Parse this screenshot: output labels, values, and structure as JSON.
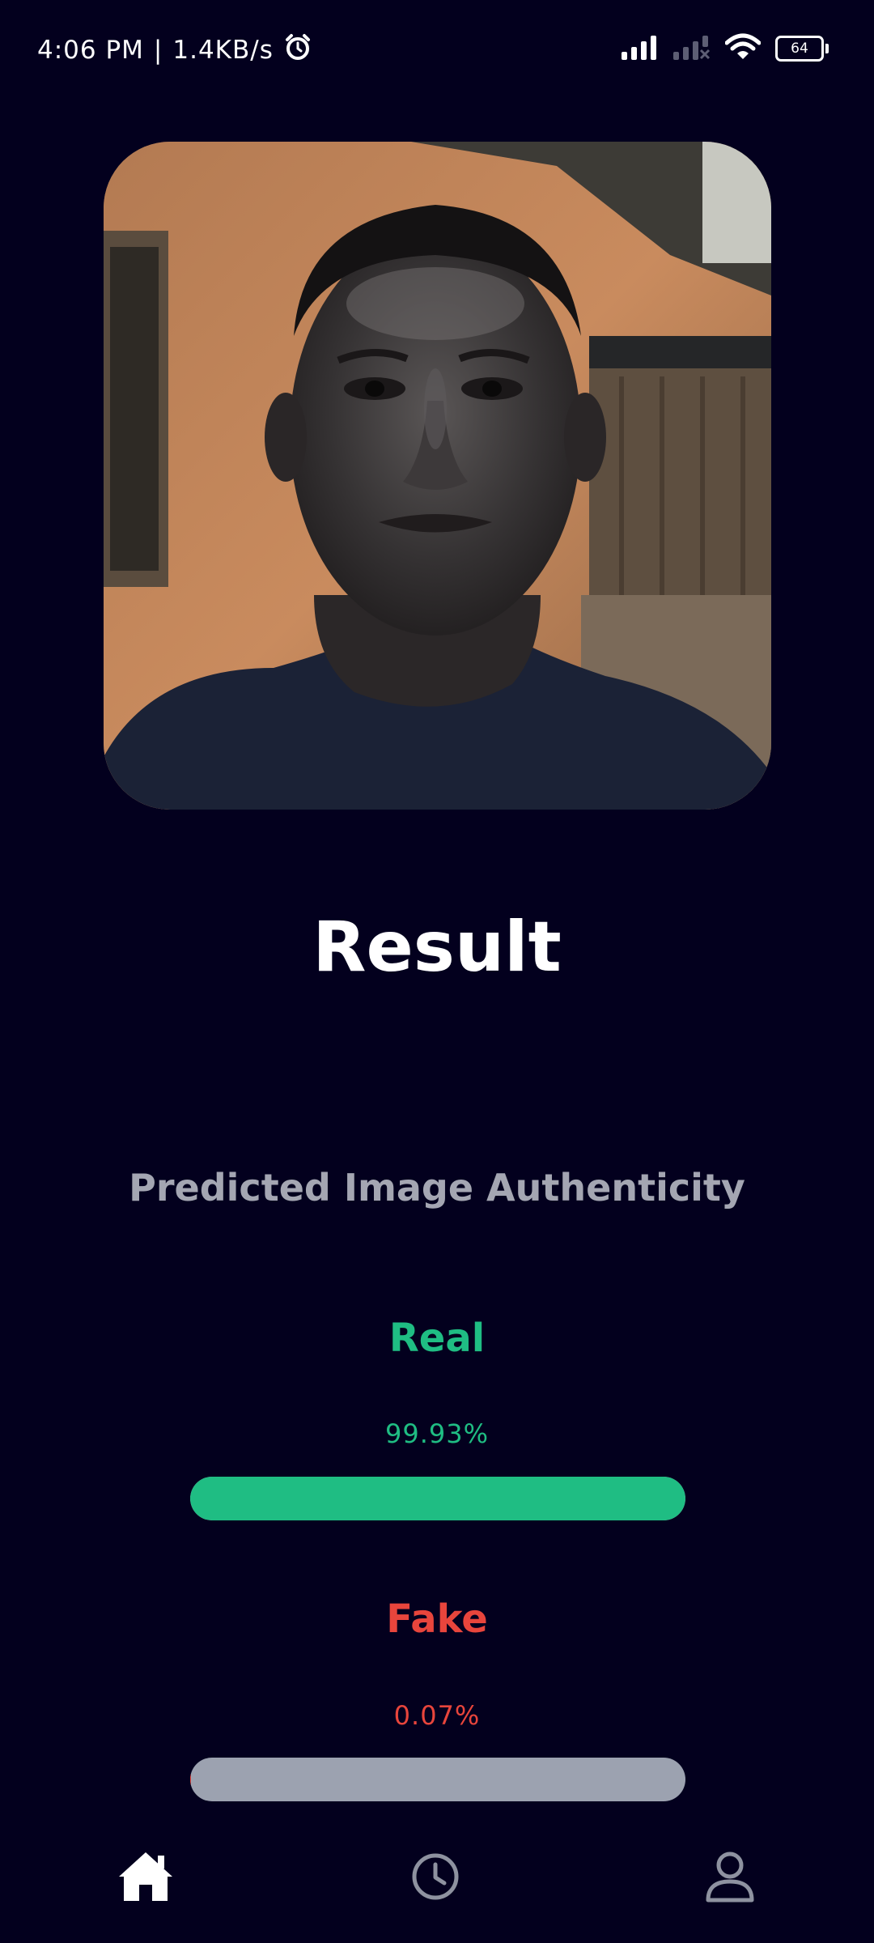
{
  "status_bar": {
    "time": "4:06 PM",
    "separator": "|",
    "network_speed": "1.4KB/s",
    "battery_level": "64"
  },
  "photo": {
    "subject": "portrait-photo"
  },
  "result": {
    "title": "Result",
    "subtitle": "Predicted Image Authenticity"
  },
  "predictions": {
    "real": {
      "label": "Real",
      "value_text": "99.93%",
      "fraction": 0.9993,
      "color": "#1fbd83"
    },
    "fake": {
      "label": "Fake",
      "value_text": "0.07%",
      "fraction": 0.0007,
      "color": "#e8453c"
    }
  },
  "colors": {
    "background": "#03001e",
    "track": "#9ca2b0",
    "subtitle": "#a4a6b2"
  },
  "bottom_nav": {
    "items": [
      {
        "icon": "home-icon",
        "active": true
      },
      {
        "icon": "history-icon",
        "active": false
      },
      {
        "icon": "profile-icon",
        "active": false
      }
    ]
  }
}
